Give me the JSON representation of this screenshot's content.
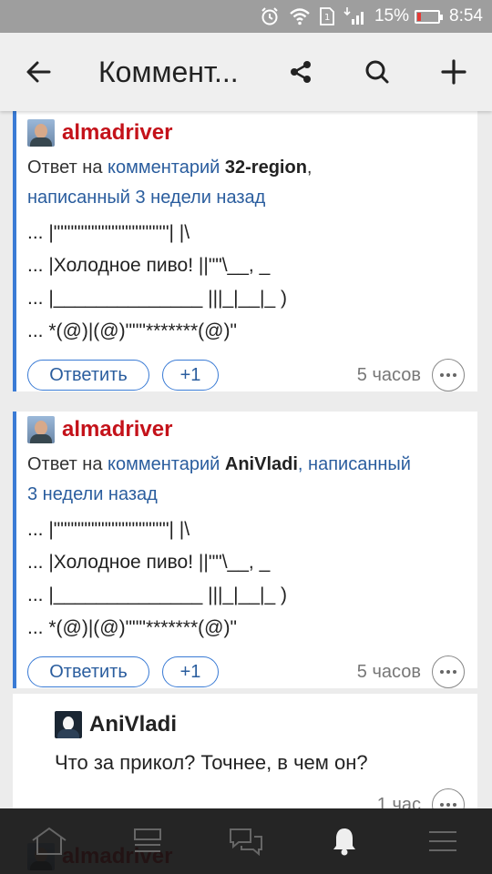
{
  "status_bar": {
    "battery_percent": "15%",
    "time": "8:54",
    "icons": [
      "alarm-icon",
      "wifi-icon",
      "sim-icon",
      "signal-icon"
    ]
  },
  "app_bar": {
    "title": "Коммент...",
    "icons": [
      "back-arrow-icon",
      "share-icon",
      "search-icon",
      "plus-icon"
    ]
  },
  "comments": [
    {
      "author": "almadriver",
      "meta_prefix": "Ответ на",
      "meta_link": "комментарий",
      "meta_user": "32-region",
      "meta_suffix_line1": ",",
      "meta_written": "написанный 3 недели назад",
      "body": [
        "... |\"\"\"\"\"\"\"\"\"\"\"\"\"\"\"\"\"| |\\",
        "... |Холодное пиво! ||\"\"\\__, _",
        "... |______________ |||_|__|_ )",
        "... *(@)|(@)\"\"\"*******(@)\""
      ],
      "reply_label": "Ответить",
      "plus_label": "+1",
      "time": "5 часов"
    },
    {
      "author": "almadriver",
      "meta_prefix": "Ответ на",
      "meta_link": "комментарий",
      "meta_user": "AniVladi",
      "meta_suffix_line1": ", написанный",
      "meta_written": "3 недели назад",
      "body": [
        "... |\"\"\"\"\"\"\"\"\"\"\"\"\"\"\"\"\"| |\\",
        "... |Холодное пиво! ||\"\"\\__, _",
        "... |______________ |||_|__|_ )",
        "... *(@)|(@)\"\"\"*******(@)\""
      ],
      "reply_label": "Ответить",
      "plus_label": "+1",
      "time": "5 часов"
    },
    {
      "author": "AniVladi",
      "body": "Что за прикол? Точнее, в чем он?",
      "time": "1 час"
    },
    {
      "author": "almadriver"
    }
  ],
  "bottom_nav": [
    "home-icon",
    "feed-icon",
    "messages-icon",
    "notifications-icon",
    "menu-icon"
  ],
  "colors": {
    "accent_blue": "#3a7bd5",
    "author_red": "#c4121a",
    "status_bar": "#9e9e9e"
  }
}
